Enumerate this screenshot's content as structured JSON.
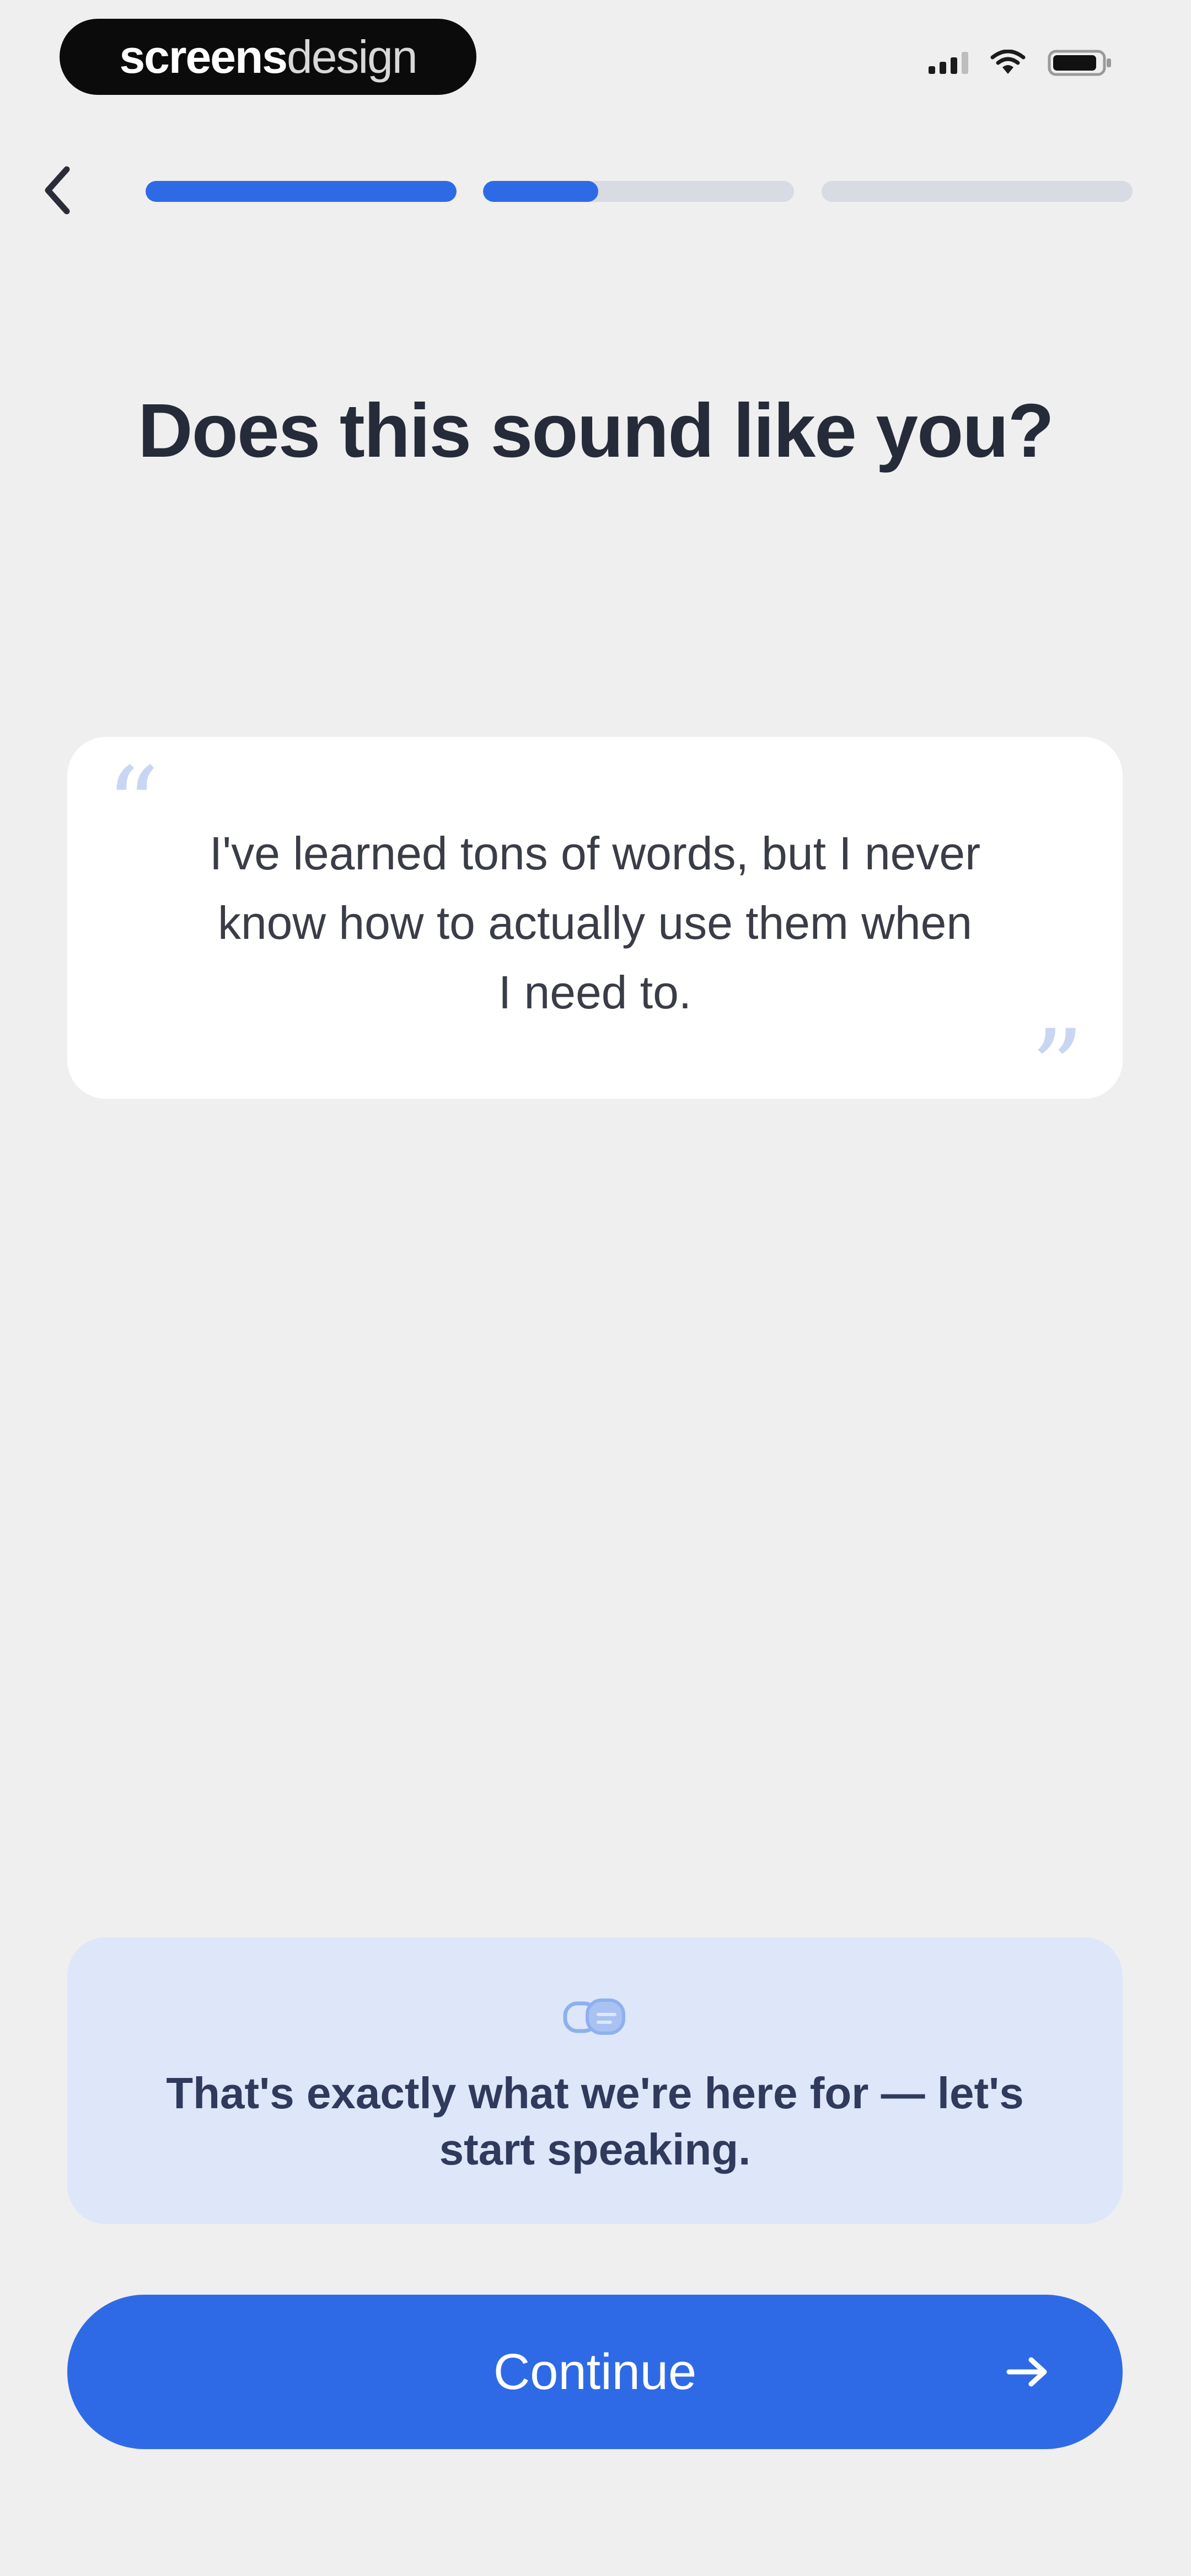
{
  "status_bar": {
    "watermark_bold": "screens",
    "watermark_light": "design",
    "signal_icon": "signal-icon",
    "wifi_icon": "wifi-icon",
    "battery_icon": "battery-icon"
  },
  "header": {
    "back_icon": "chevron-left-icon",
    "progress": [
      {
        "fill": 1.0
      },
      {
        "fill": 0.37
      },
      {
        "fill": 0.0
      }
    ]
  },
  "main": {
    "title": "Does this sound like you?",
    "quote": {
      "open_mark": "“",
      "text": "I've learned tons of words, but I never know how to actually use them when I need to.",
      "close_mark": "”"
    },
    "info": {
      "icon": "chat-bubbles-icon",
      "text": "That's exactly what we're here for — let's start speaking."
    }
  },
  "footer": {
    "continue_label": "Continue",
    "arrow_icon": "arrow-right-icon"
  },
  "colors": {
    "accent": "#2f6ae6",
    "background": "#efefef",
    "info_background": "#dde7f9",
    "title": "#262b3a"
  }
}
